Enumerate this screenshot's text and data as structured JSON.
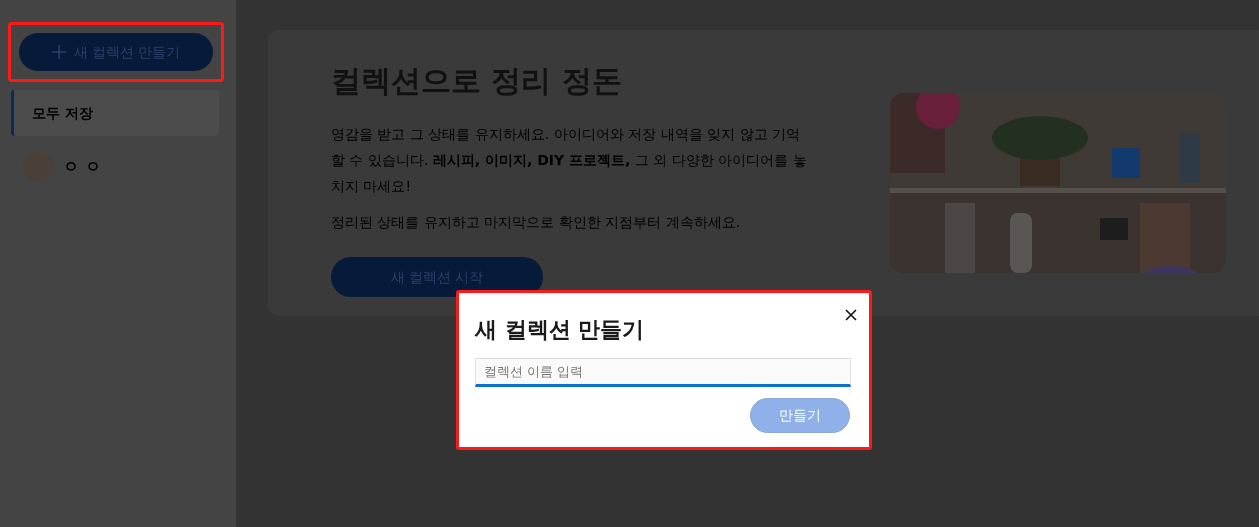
{
  "sidebar": {
    "new_collection_button": {
      "label": "새 컬렉션 만들기",
      "highlighted": true
    },
    "items": [
      {
        "kind": "plain",
        "label": "모두 저장",
        "selected": true
      },
      {
        "kind": "avatar",
        "label": "ㅇ ㅇ",
        "selected": false
      }
    ]
  },
  "main": {
    "title": "컬렉션으로 정리 정돈",
    "paragraphs": [
      "영감을 받고 그 상태를 유지하세요. 아이디어와 저장 내역을 잊지 않고 기억할 수 있습니다. **레시피, 이미지, DIY 프로젝트,** 그 외 다양한 아이디어를 놓치지 마세요!",
      "정리된 상태를 유지하고 마지막으로 확인한 지점부터 계속하세요."
    ],
    "start_button": "새 컬렉션 시작"
  },
  "dialog": {
    "title": "새 컬렉션 만들기",
    "highlighted": true,
    "name_field": {
      "placeholder": "컬렉션 이름 입력"
    },
    "create_button": {
      "label": "만들기",
      "disabled": true
    }
  }
}
